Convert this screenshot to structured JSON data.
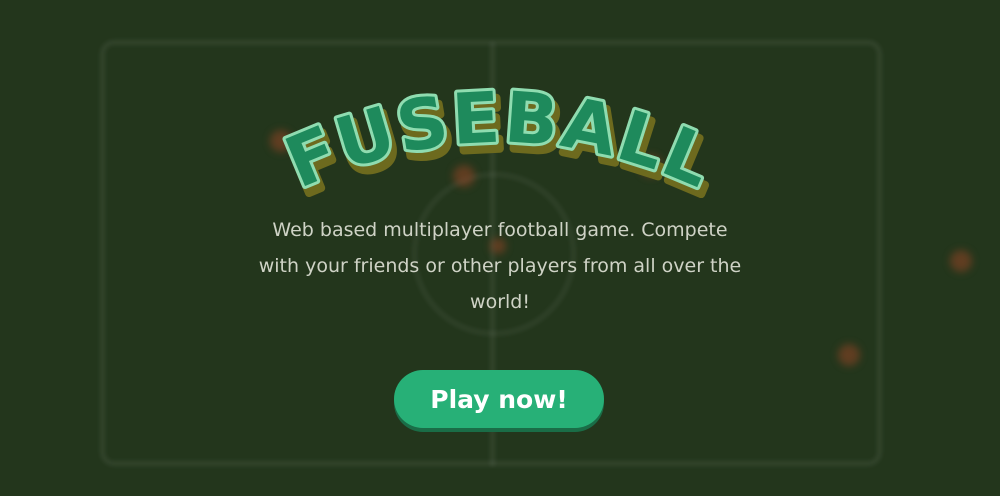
{
  "game": {
    "title": "FUSEBALL",
    "description": "Web based multiplayer football game. Compete with your friends or other players from all over the world!",
    "play_button_label": "Play now!"
  },
  "colors": {
    "background": "#23361c",
    "title_fill": "#1e8a5c",
    "title_outline": "#8fdcb0",
    "title_shadow": "#6d6a1e",
    "button": "#27b077",
    "button_shadow": "#1a6d47",
    "description_text": "#cfd3c6"
  }
}
